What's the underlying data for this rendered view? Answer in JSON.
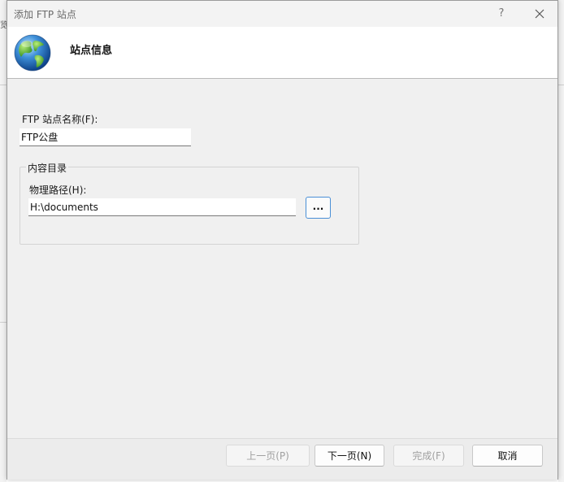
{
  "window": {
    "title": "添加 FTP 站点",
    "help_label": "?",
    "close_icon": "close-icon"
  },
  "header": {
    "title": "站点信息",
    "icon": "globe-icon"
  },
  "site_name": {
    "label": "FTP 站点名称(F):",
    "value": "FTP公盘"
  },
  "content_directory": {
    "legend": "内容目录",
    "physical_path_label": "物理路径(H):",
    "physical_path_value": "H:\\documents",
    "browse_label": "..."
  },
  "footer": {
    "prev_label": "上一页(P)",
    "next_label": "下一页(N)",
    "finish_label": "完成(F)",
    "cancel_label": "取消"
  },
  "background": {
    "left_edge_text": "览"
  }
}
